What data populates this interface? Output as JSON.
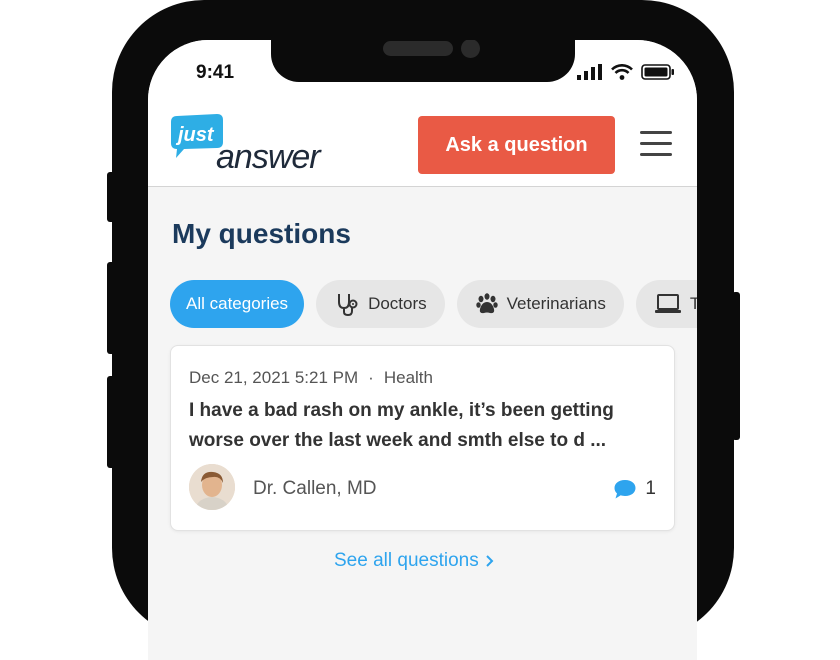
{
  "status_bar": {
    "time": "9:41"
  },
  "header": {
    "logo": {
      "top": "just",
      "bottom": "answer"
    },
    "ask_label": "Ask a question"
  },
  "page": {
    "title": "My questions"
  },
  "categories": [
    {
      "label": "All categories",
      "icon": "none",
      "selected": true
    },
    {
      "label": "Doctors",
      "icon": "stethoscope-icon",
      "selected": false
    },
    {
      "label": "Veterinarians",
      "icon": "paw-icon",
      "selected": false
    },
    {
      "label": "Te",
      "icon": "laptop-icon",
      "selected": false
    }
  ],
  "question": {
    "date": "Dec 21, 2021 5:21 PM",
    "separator": "·",
    "category": "Health",
    "text": "I have a bad rash on my ankle, it’s been getting worse over the last week and smth else to d ...",
    "expert": "Dr. Callen, MD",
    "reply_count": "1"
  },
  "see_all_label": "See all questions",
  "colors": {
    "accent": "#2ea4ee",
    "cta": "#e95a45",
    "title": "#1b3a5c",
    "logo_bubble": "#2eaee5"
  }
}
